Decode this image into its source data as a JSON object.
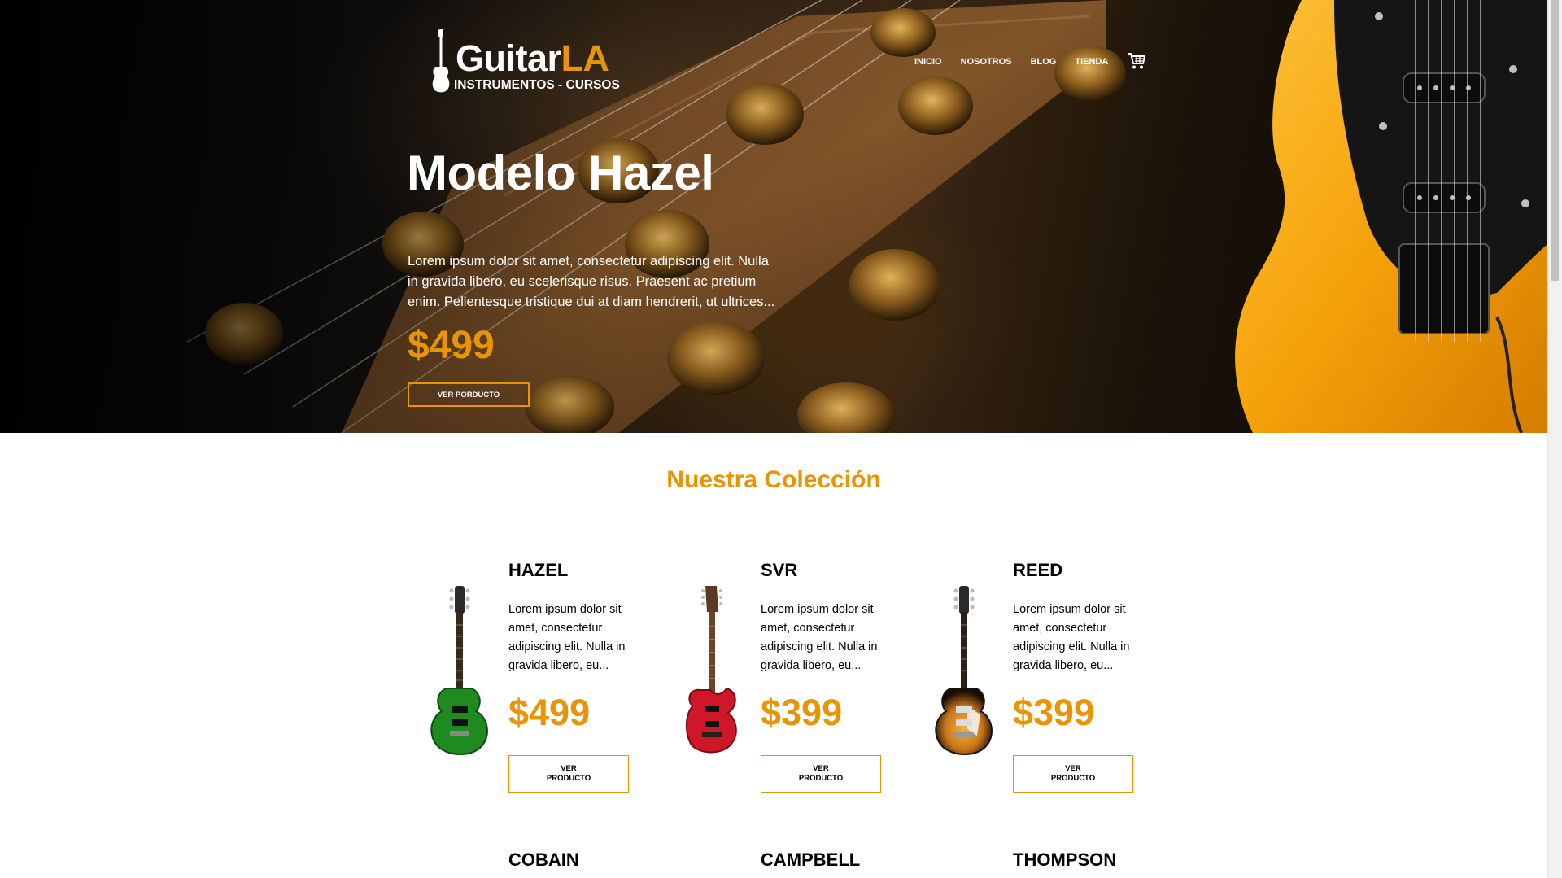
{
  "header": {
    "logo_main": "Guitar",
    "logo_accent": "LA",
    "logo_sub": "INSTRUMENTOS - CURSOS",
    "nav": [
      "INICIO",
      "NOSOTROS",
      "BLOG",
      "TIENDA"
    ],
    "cart_icon": "cart-icon"
  },
  "hero": {
    "title": "Modelo Hazel",
    "description": "Lorem ipsum dolor sit amet, consectetur adipiscing elit. Nulla in gravida libero, eu scelerisque risus. Praesent ac pretium enim. Pellentesque tristique dui at diam hendrerit, ut ultrices...",
    "price": "$499",
    "button": "VER PORDUCTO"
  },
  "collection": {
    "title": "Nuestra Colección",
    "products": [
      {
        "name": "HAZEL",
        "description": "Lorem ipsum dolor sit amet, consectetur adipiscing elit. Nulla in gravida libero, eu...",
        "price": "$499",
        "button": "VER PRODUCTO",
        "guitar_color": "#1f8a1f"
      },
      {
        "name": "SVR",
        "description": "Lorem ipsum dolor sit amet, consectetur adipiscing elit. Nulla in gravida libero, eu...",
        "price": "$399",
        "button": "VER PRODUCTO",
        "guitar_color": "#d0172a"
      },
      {
        "name": "REED",
        "description": "Lorem ipsum dolor sit amet, consectetur adipiscing elit. Nulla in gravida libero, eu...",
        "price": "$399",
        "button": "VER PRODUCTO",
        "guitar_color": "#c9761a"
      }
    ],
    "next_row": [
      "COBAIN",
      "CAMPBELL",
      "THOMPSON"
    ]
  },
  "colors": {
    "accent": "#e99402",
    "hero_dark": "#0b0b0b"
  }
}
